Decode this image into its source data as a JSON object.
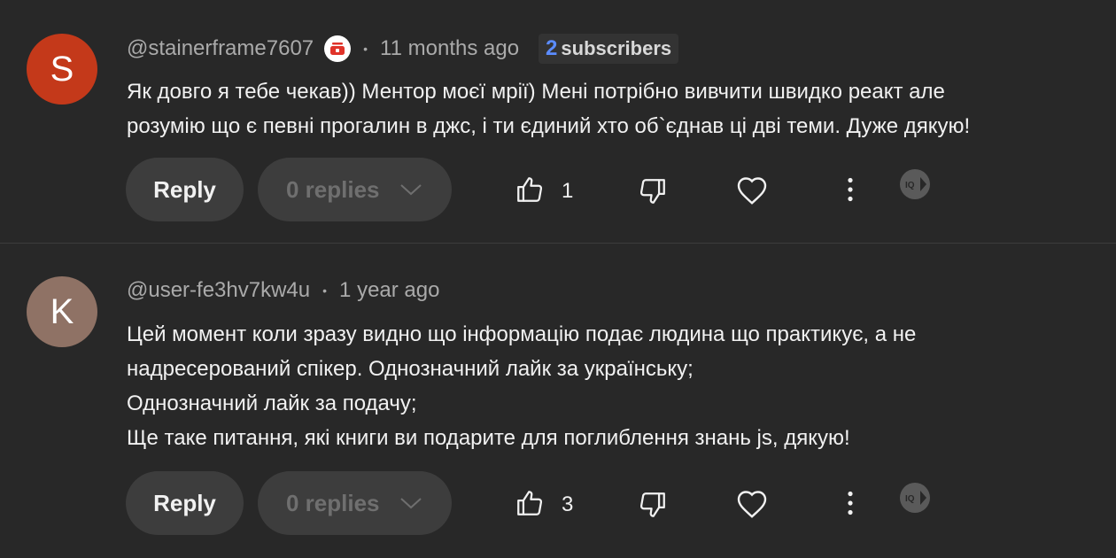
{
  "comments": [
    {
      "avatar_letter": "S",
      "avatar_color": "#c4391a",
      "username": "@stainerframe7607",
      "has_badge": true,
      "time": "11 months ago",
      "subscribers_num": "2",
      "subscribers_label": "subscribers",
      "lines": [
        "Як довго я тебе чекав)) Ментор моєї мрії) Мені потрібно вивчити швидко реакт але",
        "розумію що є певні прогалин в джс, і ти єдиний хто об`єднав ці дві теми.  Дуже дякую!"
      ],
      "reply_label": "Reply",
      "replies_label": "0 replies",
      "likes": "1",
      "icons": [
        "thumbs-up-icon",
        "thumbs-down-icon",
        "heart-icon",
        "more-vert-icon",
        "iq-icon"
      ]
    },
    {
      "avatar_letter": "K",
      "avatar_color": "#8f7265",
      "username": "@user-fe3hv7kw4u",
      "has_badge": false,
      "time": "1 year ago",
      "lines": [
        "Цей момент коли зразу видно що інформацію подає людина що практикує, а не",
        "надресерований спікер. Однозначний лайк за українську;",
        "Однозначний лайк за подачу;",
        "Ще таке питання, які книги ви подарите для поглиблення знань js, дякую!"
      ],
      "reply_label": "Reply",
      "replies_label": "0 replies",
      "likes": "3",
      "icons": [
        "thumbs-up-icon",
        "thumbs-down-icon",
        "heart-icon",
        "more-vert-icon",
        "iq-icon"
      ]
    }
  ],
  "meta_separator": "•",
  "iq_label": "IQ",
  "colors": {
    "background": "#282828",
    "text": "#f1f1f1",
    "secondary_text": "#aaaaaa",
    "button_bg": "#3d3d3d",
    "subscriber_count": "#5b8cff",
    "badge_red": "#e0332a"
  }
}
